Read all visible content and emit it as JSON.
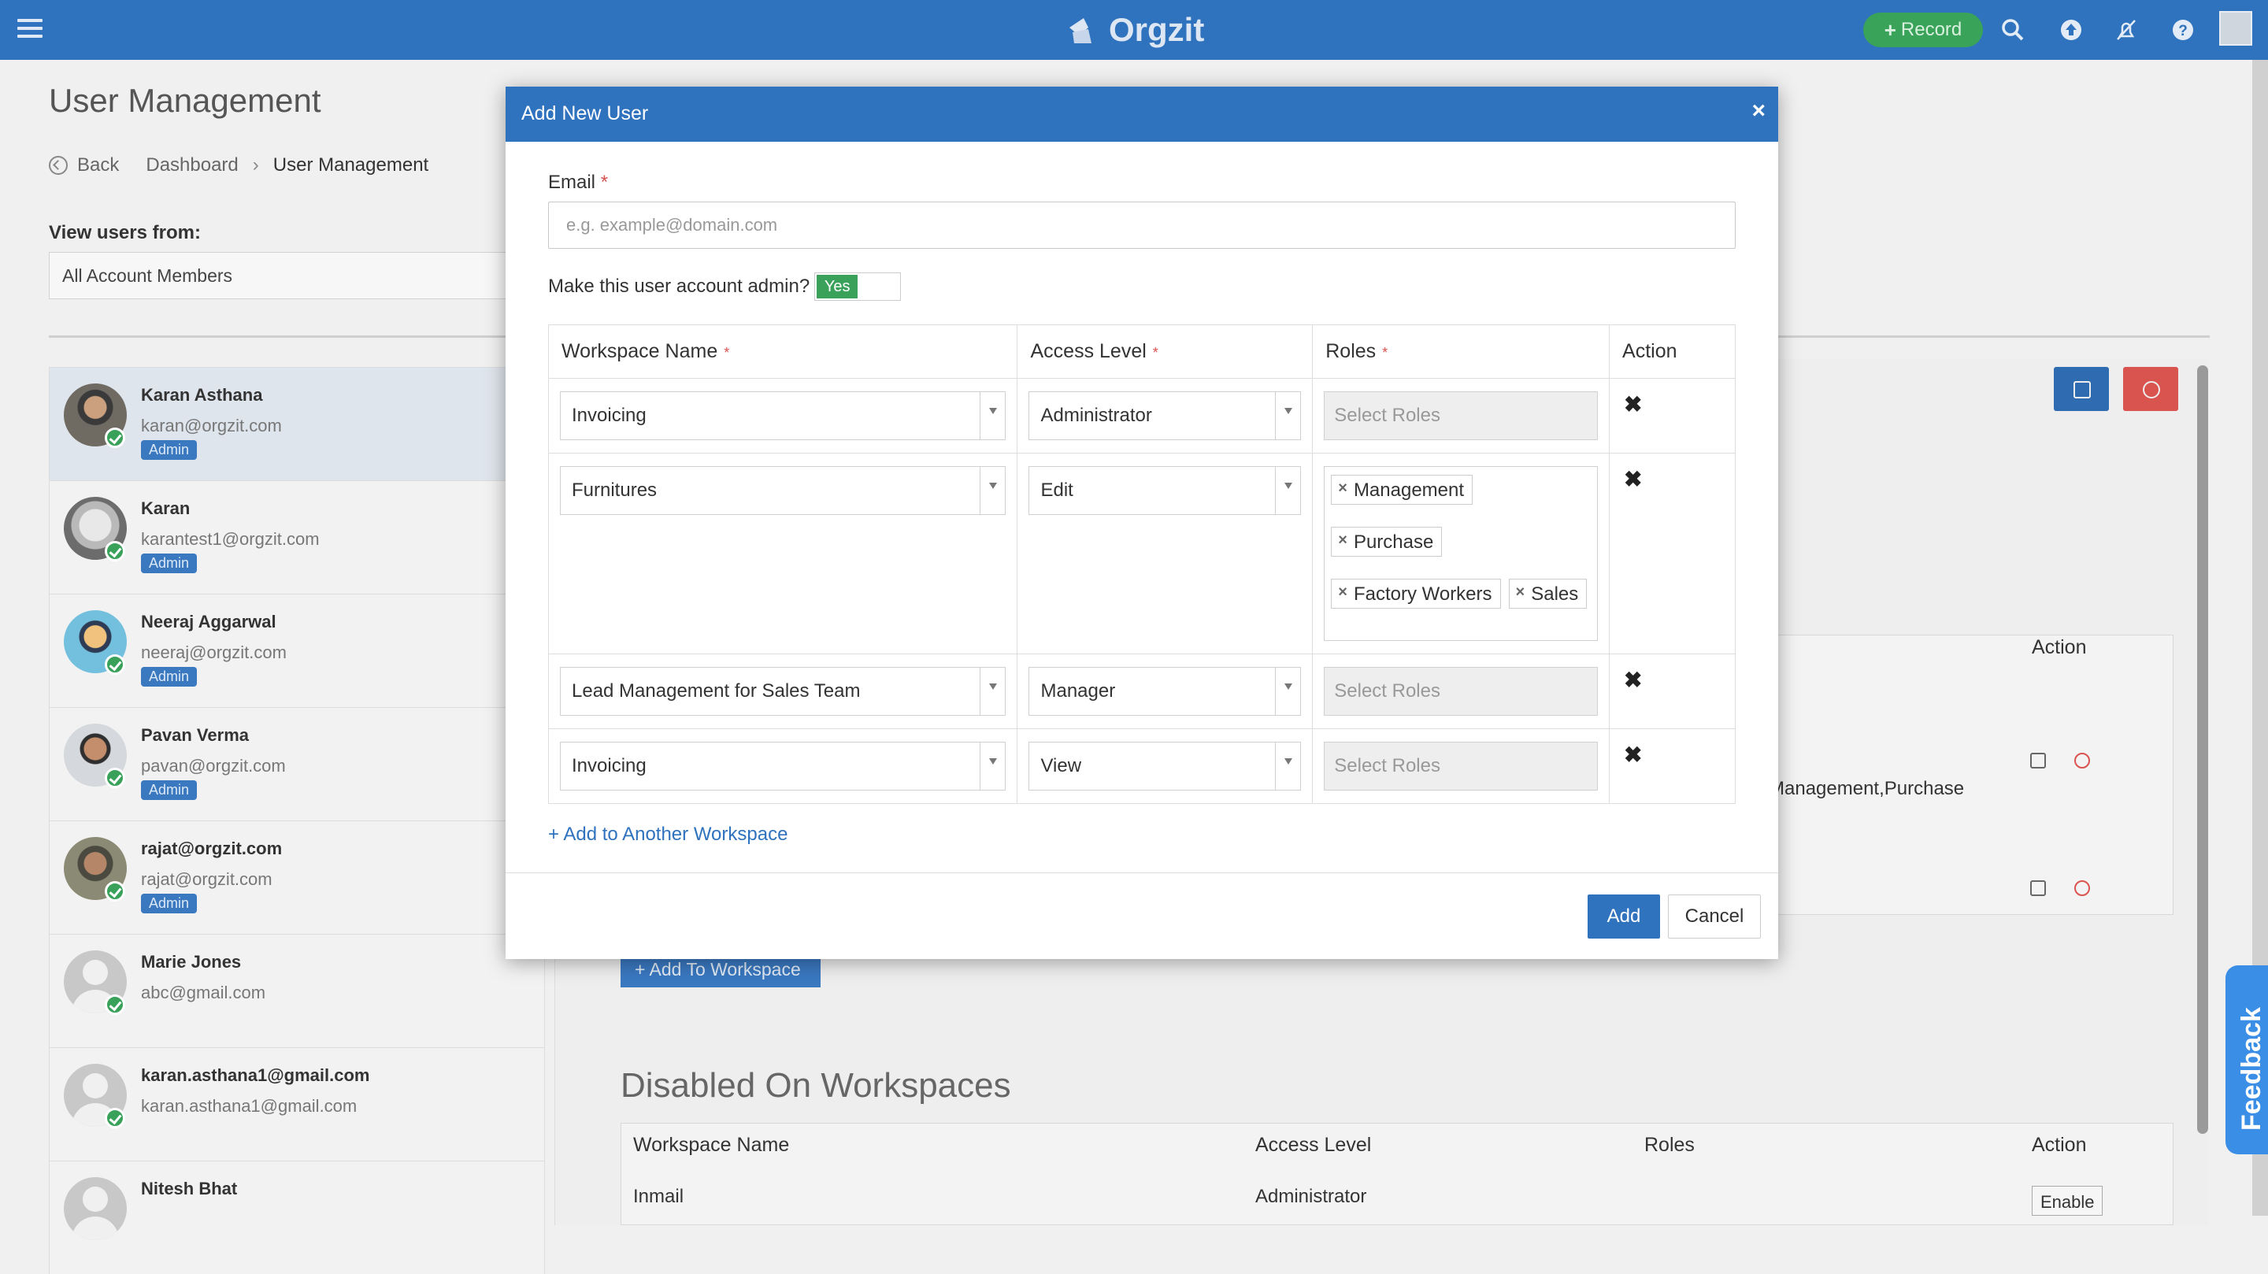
{
  "topbar": {
    "brand": "Orgzit",
    "record_label": "Record",
    "icons": [
      "menu-icon",
      "search-icon",
      "upload-icon",
      "notifications-off-icon",
      "help-icon"
    ]
  },
  "page": {
    "title": "User Management",
    "breadcrumb": {
      "back": "Back",
      "dashboard": "Dashboard",
      "current": "User Management"
    },
    "view_users_label": "View users from:",
    "view_users_value": "All Account Members"
  },
  "users": [
    {
      "name": "Karan Asthana",
      "email": "karan@orgzit.com",
      "badge": "Admin"
    },
    {
      "name": "Karan",
      "email": "karantest1@orgzit.com",
      "badge": "Admin"
    },
    {
      "name": "Neeraj Aggarwal",
      "email": "neeraj@orgzit.com",
      "badge": "Admin"
    },
    {
      "name": "Pavan Verma",
      "email": "pavan@orgzit.com",
      "badge": "Admin"
    },
    {
      "name": "rajat@orgzit.com",
      "email": "rajat@orgzit.com",
      "badge": "Admin"
    },
    {
      "name": "Marie Jones",
      "email": "abc@gmail.com",
      "badge": ""
    },
    {
      "name": "karan.asthana1@gmail.com",
      "email": "karan.asthana1@gmail.com",
      "badge": ""
    },
    {
      "name": "Nitesh Bhat",
      "email": "",
      "badge": ""
    }
  ],
  "background": {
    "action_header": "Action",
    "roles_text": "Management,Purchase",
    "add_to_workspace": "+ Add To Workspace",
    "disabled_title": "Disabled On Workspaces",
    "disabled_headers": [
      "Workspace Name",
      "Access Level",
      "Roles",
      "Action"
    ],
    "disabled_row": {
      "workspace": "Inmail",
      "access": "Administrator",
      "roles": "",
      "action": "Enable"
    },
    "feedback": "Feedback"
  },
  "modal": {
    "title": "Add New User",
    "email_label": "Email",
    "email_placeholder": "e.g. example@domain.com",
    "admin_question": "Make this user account admin?",
    "admin_toggle": "Yes",
    "headers": {
      "workspace": "Workspace Name",
      "access": "Access Level",
      "roles": "Roles",
      "action": "Action"
    },
    "roles_placeholder": "Select Roles",
    "rows": [
      {
        "workspace": "Invoicing",
        "access": "Administrator",
        "roles": []
      },
      {
        "workspace": "Furnitures",
        "access": "Edit",
        "roles": [
          "Management",
          "Purchase",
          "Factory Workers",
          "Sales"
        ]
      },
      {
        "workspace": "Lead Management for Sales Team",
        "access": "Manager",
        "roles": []
      },
      {
        "workspace": "Invoicing",
        "access": "View",
        "roles": []
      }
    ],
    "add_another": "+ Add to Another Workspace",
    "add_button": "Add",
    "cancel_button": "Cancel"
  }
}
